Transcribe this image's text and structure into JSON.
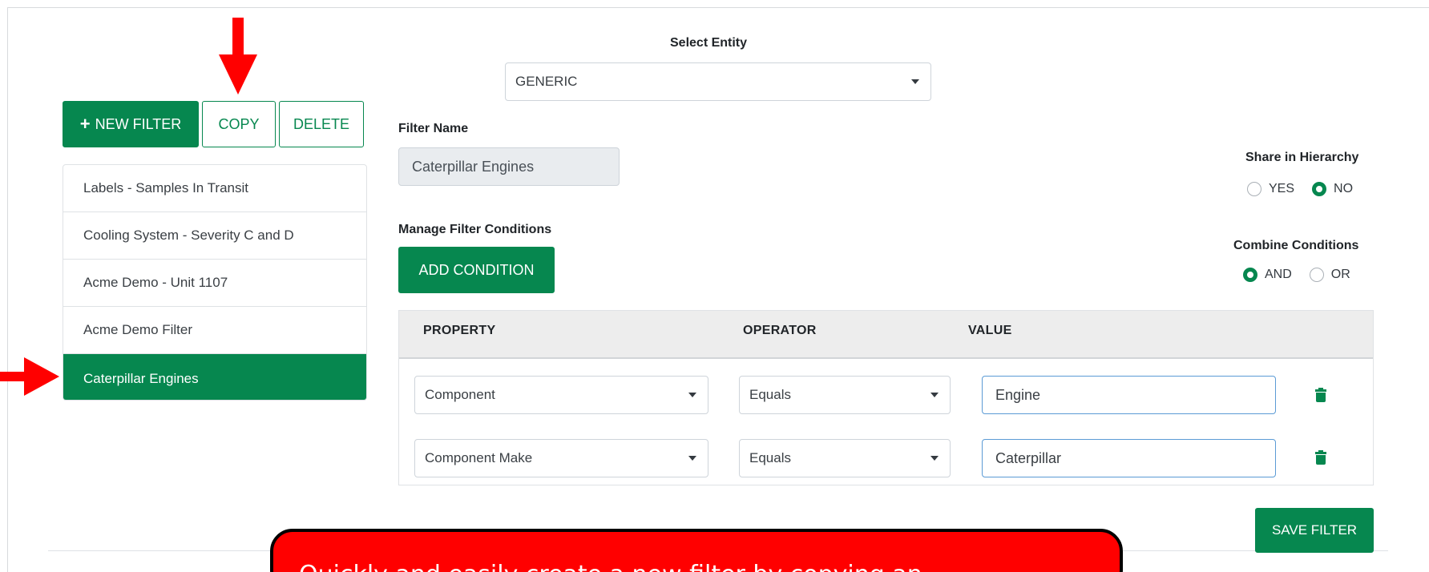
{
  "toolbar": {
    "new_filter_label": "NEW FILTER",
    "copy_label": "COPY",
    "delete_label": "DELETE"
  },
  "filters": [
    {
      "label": "Labels - Samples In Transit"
    },
    {
      "label": "Cooling System - Severity C and D"
    },
    {
      "label": "Acme Demo - Unit 1107"
    },
    {
      "label": "Acme Demo Filter"
    },
    {
      "label": "Caterpillar Engines",
      "active": true
    }
  ],
  "entity": {
    "label": "Select Entity",
    "value": "GENERIC"
  },
  "filter_name": {
    "label": "Filter Name",
    "value": "Caterpillar Engines"
  },
  "share": {
    "label": "Share in Hierarchy",
    "options": [
      "YES",
      "NO"
    ],
    "selected": "NO"
  },
  "conditions": {
    "label": "Manage Filter Conditions",
    "add_label": "ADD CONDITION",
    "combine_label": "Combine Conditions",
    "combine_options": [
      "AND",
      "OR"
    ],
    "combine_selected": "AND",
    "headers": [
      "PROPERTY",
      "OPERATOR",
      "VALUE"
    ],
    "rows": [
      {
        "property": "Component",
        "operator": "Equals",
        "value": "Engine"
      },
      {
        "property": "Component Make",
        "operator": "Equals",
        "value": "Caterpillar"
      }
    ]
  },
  "save_label": "SAVE FILTER",
  "callout": {
    "text": "Quickly and easily create a new filter by copying an"
  },
  "colors": {
    "accent": "#06874f",
    "annotation": "#ff0000"
  }
}
